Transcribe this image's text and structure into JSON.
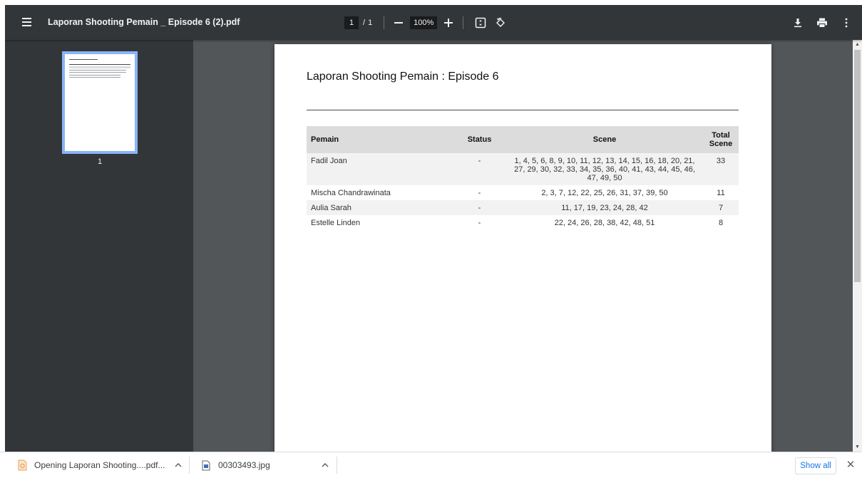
{
  "toolbar": {
    "title": "Laporan Shooting Pemain _ Episode 6 (2).pdf",
    "page_current": "1",
    "page_separator": "/",
    "page_total": "1",
    "zoom": "100%"
  },
  "sidebar": {
    "thumb_page_number": "1"
  },
  "document": {
    "title": "Laporan Shooting Pemain : Episode 6",
    "table": {
      "headers": {
        "pemain": "Pemain",
        "status": "Status",
        "scene": "Scene",
        "total_line1": "Total",
        "total_line2": "Scene"
      },
      "rows": [
        {
          "pemain": "Fadil Joan",
          "status": "-",
          "scene": "1, 4, 5, 6, 8, 9, 10, 11, 12, 13, 14, 15, 16, 18, 20, 21, 27, 29, 30, 32, 33, 34, 35, 36, 40, 41, 43, 44, 45, 46, 47, 49, 50",
          "total": "33"
        },
        {
          "pemain": "Mischa Chandrawinata",
          "status": "-",
          "scene": "2, 3, 7, 12, 22, 25, 26, 31, 37, 39, 50",
          "total": "11"
        },
        {
          "pemain": "Aulia Sarah",
          "status": "-",
          "scene": "11, 17, 19, 23, 24, 28, 42",
          "total": "7"
        },
        {
          "pemain": "Estelle Linden",
          "status": "-",
          "scene": "22, 24, 26, 28, 38, 42, 48, 51",
          "total": "8"
        }
      ]
    }
  },
  "downloads": {
    "items": [
      {
        "label": "Opening Laporan Shooting....pdf..."
      },
      {
        "label": "00303493.jpg"
      }
    ],
    "show_all_label": "Show all"
  },
  "icons": {
    "menu": "hamburger-menu-icon",
    "zoom_out": "minus-icon",
    "zoom_in": "plus-icon",
    "fit": "fit-to-page-icon",
    "rotate": "rotate-icon",
    "download": "download-icon",
    "print": "print-icon",
    "more": "more-vert-icon",
    "pdf_file": "pdf-file-icon",
    "image_file": "image-file-icon",
    "chevron": "chevron-up-icon",
    "close": "close-icon"
  },
  "colors": {
    "toolbar_bg": "#323639",
    "viewer_bg": "#525659",
    "thumb_border": "#8ab4f8",
    "table_header_bg": "#dcdcdc",
    "link_blue": "#1a73e8"
  }
}
